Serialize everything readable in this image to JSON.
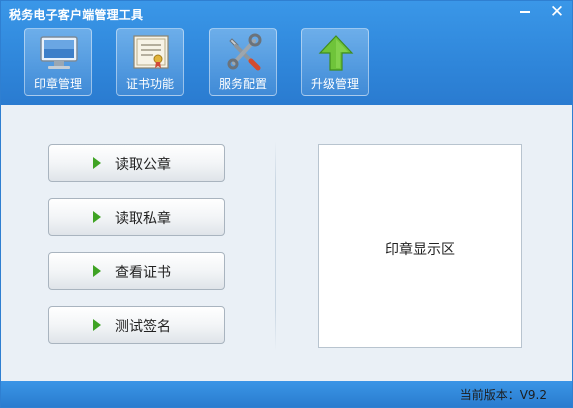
{
  "window": {
    "title": "税务电子客户端管理工具"
  },
  "toolbar": {
    "items": [
      {
        "label": "印章管理",
        "icon": "monitor-icon"
      },
      {
        "label": "证书功能",
        "icon": "certificate-icon"
      },
      {
        "label": "服务配置",
        "icon": "tools-icon"
      },
      {
        "label": "升级管理",
        "icon": "upgrade-arrow-icon"
      }
    ]
  },
  "actions": [
    {
      "label": "读取公章"
    },
    {
      "label": "读取私章"
    },
    {
      "label": "查看证书"
    },
    {
      "label": "测试签名"
    }
  ],
  "seal_panel": {
    "label": "印章显示区"
  },
  "footer": {
    "version": "当前版本：V9.2"
  },
  "colors": {
    "header": "#2f86da",
    "accent_arrow": "#3fa324",
    "upgrade_arrow": "#6fc43a"
  }
}
